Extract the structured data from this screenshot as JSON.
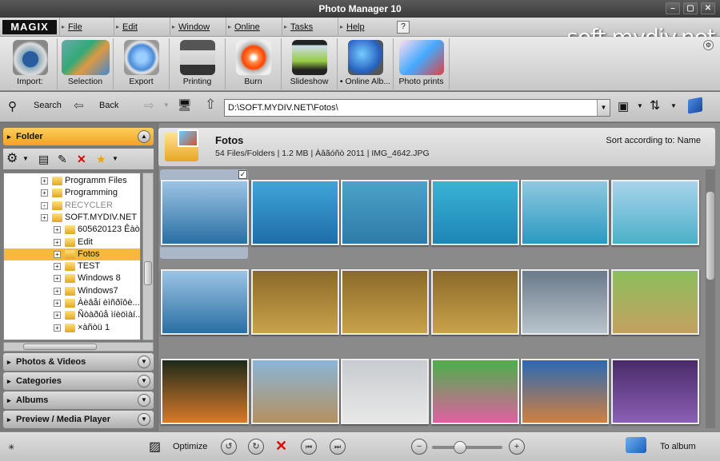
{
  "window": {
    "title": "Photo Manager 10",
    "controls": [
      "–",
      "▢",
      "✕"
    ]
  },
  "brand": {
    "logo": "MAGIX",
    "watermark": "soft.mydiv.net"
  },
  "menu": [
    {
      "label": "File"
    },
    {
      "label": "Edit"
    },
    {
      "label": "Window"
    },
    {
      "label": "Online"
    },
    {
      "label": "Tasks"
    },
    {
      "label": "Help"
    }
  ],
  "toolbar": [
    {
      "label": "Import:",
      "icon": "camera-icon"
    },
    {
      "label": "Selection",
      "icon": "selection-icon"
    },
    {
      "label": "Export",
      "icon": "export-icon"
    },
    {
      "label": "Printing",
      "icon": "printer-icon"
    },
    {
      "label": "Burn",
      "icon": "burn-disc-icon"
    },
    {
      "label": "Slideshow",
      "icon": "slideshow-icon"
    },
    {
      "label": "• Online Alb...",
      "icon": "globe-icon"
    },
    {
      "label": "Photo prints",
      "icon": "photo-prints-icon"
    }
  ],
  "nav": {
    "search": "Search",
    "back": "Back",
    "path": "D:\\SOFT.MYDIV.NET\\Fotos\\"
  },
  "left_panel": {
    "folder_title": "Folder",
    "tree": [
      {
        "label": "Programm Files",
        "indent": 0,
        "state": "normal"
      },
      {
        "label": "Programming",
        "indent": 0,
        "state": "normal"
      },
      {
        "label": "RECYCLER",
        "indent": 0,
        "state": "dim"
      },
      {
        "label": "SOFT.MYDIV.NET",
        "indent": 0,
        "state": "normal"
      },
      {
        "label": "605620123 Êàò...",
        "indent": 1,
        "state": "normal"
      },
      {
        "label": "Edit",
        "indent": 1,
        "state": "normal"
      },
      {
        "label": "Fotos",
        "indent": 1,
        "state": "selected"
      },
      {
        "label": "TEST",
        "indent": 1,
        "state": "normal"
      },
      {
        "label": "Windows 8",
        "indent": 1,
        "state": "normal"
      },
      {
        "label": "Windows7",
        "indent": 1,
        "state": "normal"
      },
      {
        "label": "Àèâåí èìñðîôè...",
        "indent": 1,
        "state": "normal"
      },
      {
        "label": "Ñòàðûå ìíèöìàí...",
        "indent": 1,
        "state": "normal"
      },
      {
        "label": "×àñòü 1",
        "indent": 1,
        "state": "normal"
      }
    ],
    "sections": [
      "Photos & Videos",
      "Categories",
      "Albums",
      "Preview / Media Player"
    ]
  },
  "folder_header": {
    "name": "Fotos",
    "info": "54 Files/Folders | 1.2 MB | Àâãóñò 2011 | IMG_4642.JPG",
    "sort": "Sort according to: Name"
  },
  "thumbnails": [
    {
      "subject": "white yacht on sea",
      "colors": [
        "#9cc4e4",
        "#2a6fa4"
      ]
    },
    {
      "subject": "underwater pool ladder",
      "colors": [
        "#3fa5d8",
        "#1e6ea8"
      ]
    },
    {
      "subject": "shallow clear water",
      "colors": [
        "#4aa3c8",
        "#2f7aa8"
      ]
    },
    {
      "subject": "divers underwater",
      "colors": [
        "#3ab2d6",
        "#1e86b4"
      ]
    },
    {
      "subject": "swimmers in lagoon",
      "colors": [
        "#8fc8e0",
        "#2a9ac0"
      ]
    },
    {
      "subject": "beach and sea",
      "colors": [
        "#a8d4ec",
        "#4bb0c8"
      ]
    },
    {
      "subject": "white yacht on sea",
      "colors": [
        "#9cc4e4",
        "#2a6fa4"
      ]
    },
    {
      "subject": "clownfish in anemone",
      "colors": [
        "#8a6a2a",
        "#c9a24a"
      ]
    },
    {
      "subject": "clownfish in anemone",
      "colors": [
        "#8a6a2a",
        "#c9a24a"
      ]
    },
    {
      "subject": "clownfish in anemone",
      "colors": [
        "#8a6a2a",
        "#c9a24a"
      ]
    },
    {
      "subject": "monkey in water",
      "colors": [
        "#6a7a8a",
        "#b8c4cc"
      ]
    },
    {
      "subject": "goats on grass",
      "colors": [
        "#8cbf5a",
        "#c4a060"
      ]
    },
    {
      "subject": "orange monkey",
      "colors": [
        "#1e2a1a",
        "#d87a2a"
      ]
    },
    {
      "subject": "horses on plain",
      "colors": [
        "#8ab6d8",
        "#b49060"
      ]
    },
    {
      "subject": "penguin on ice",
      "colors": [
        "#c8ccd0",
        "#e8e8e8"
      ]
    },
    {
      "subject": "green insect",
      "colors": [
        "#4ab04a",
        "#e060a0"
      ]
    },
    {
      "subject": "jumping dog",
      "colors": [
        "#2a6ab4",
        "#d08040"
      ]
    },
    {
      "subject": "purple anemone",
      "colors": [
        "#4a2a6a",
        "#8a60b4"
      ]
    }
  ],
  "statusbar": {
    "optimize": "Optimize",
    "to_album": "To album",
    "zoom": 0.4
  }
}
